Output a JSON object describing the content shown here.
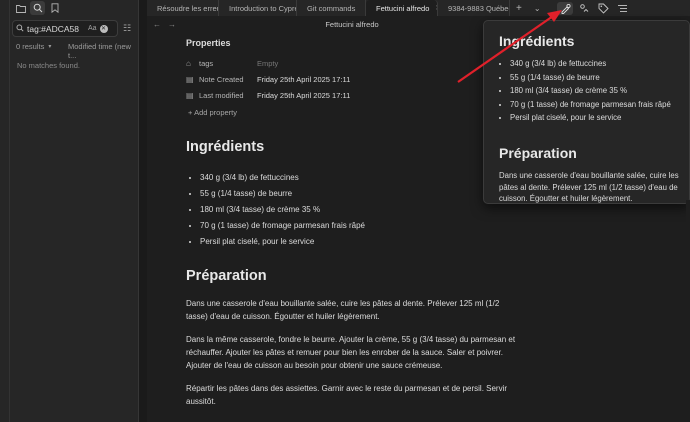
{
  "sidebar": {
    "search": {
      "value": "tag:#ADCA58",
      "match_case_label": "Aa"
    },
    "results_count": "0 results",
    "sort_label": "Modified time (new t...",
    "no_matches": "No matches found."
  },
  "tabs": [
    {
      "label": "Résoudre les erreurs ..."
    },
    {
      "label": "Introduction to Cypre..."
    },
    {
      "label": "Git commands"
    },
    {
      "label": "Fettucini alfredo"
    },
    {
      "label": "9384-9883 Québec i..."
    }
  ],
  "view": {
    "title": "Fettucini alfredo"
  },
  "properties": {
    "title": "Properties",
    "rows": [
      {
        "key": "tags",
        "value": "Empty"
      },
      {
        "key": "Note Created",
        "value": "Friday 25th April 2025 17:11"
      },
      {
        "key": "Last modified",
        "value": "Friday 25th April 2025 17:11"
      }
    ],
    "add_label": "Add property"
  },
  "note": {
    "ingredients_heading": "Ingrédients",
    "ingredients": [
      "340 g (3/4 lb) de fettuccines",
      "55 g (1/4 tasse) de beurre",
      "180 ml (3/4 tasse) de crème 35 %",
      "70 g (1 tasse) de fromage parmesan frais râpé",
      "Persil plat ciselé, pour le service"
    ],
    "preparation_heading": "Préparation",
    "paragraphs": [
      "Dans une casserole d'eau bouillante salée, cuire les pâtes al dente. Prélever 125 ml (1/2 tasse) d'eau de cuisson. Égoutter et huiler légèrement.",
      "Dans la même casserole, fondre le beurre. Ajouter la crème, 55 g (3/4 tasse) du parmesan et réchauffer. Ajouter les pâtes et remuer pour bien les enrober de la sauce. Saler et poivrer. Ajouter de l'eau de cuisson au besoin pour obtenir une sauce crémeuse.",
      "Répartir les pâtes dans des assiettes. Garnir avec le reste du parmesan et de persil. Servir aussitôt."
    ]
  },
  "popover": {
    "heading": "Ingrédients",
    "items": [
      "340 g (3/4 lb) de fettuccines",
      "55 g (1/4 tasse) de beurre",
      "180 ml (3/4 tasse) de crème 35 %",
      "70 g (1 tasse) de fromage parmesan frais râpé",
      "Persil plat ciselé, pour le service"
    ],
    "preparation_heading": "Préparation",
    "paragraph": "Dans une casserole d'eau bouillante salée, cuire les pâtes al dente. Prélever 125 ml (1/2 tasse) d'eau de cuisson. Égoutter et huiler légèrement."
  },
  "colors": {
    "annotation_arrow": "#e0202a",
    "background": "#1e1e1e",
    "sidebar": "#262626"
  },
  "icons": [
    "folder-icon",
    "search-icon",
    "bookmark-icon",
    "clear-icon",
    "sort-options-icon",
    "back-arrow-icon",
    "forward-arrow-icon",
    "tags-icon",
    "calendar-icon",
    "plus-icon",
    "hover-preview-icon",
    "outline-icon"
  ]
}
